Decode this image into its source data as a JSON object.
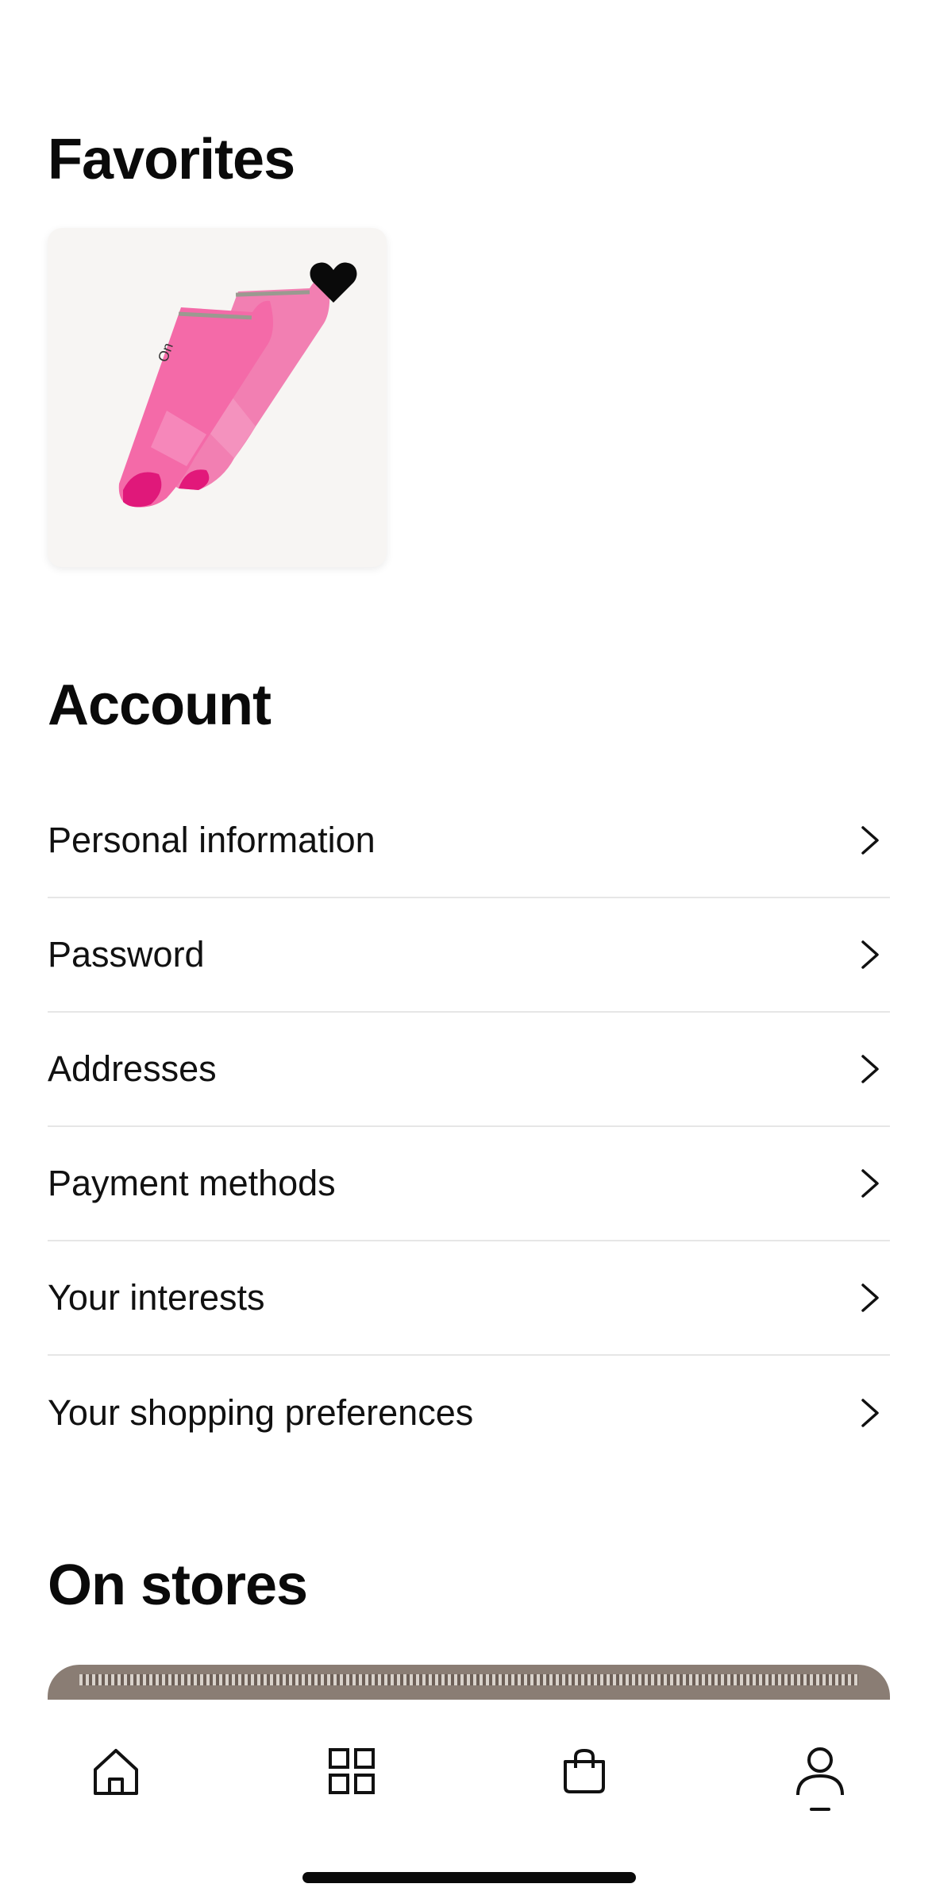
{
  "favorites": {
    "title": "Favorites",
    "items": [
      {
        "name": "pink-running-socks",
        "favorited": true
      }
    ]
  },
  "account": {
    "title": "Account",
    "items": [
      {
        "label": "Personal information"
      },
      {
        "label": "Password"
      },
      {
        "label": "Addresses"
      },
      {
        "label": "Payment methods"
      },
      {
        "label": "Your interests"
      },
      {
        "label": "Your shopping preferences"
      }
    ]
  },
  "stores": {
    "title": "On stores"
  },
  "tabbar": {
    "items": [
      {
        "icon": "home-icon"
      },
      {
        "icon": "grid-icon"
      },
      {
        "icon": "shopping-bag-icon"
      },
      {
        "icon": "person-icon",
        "active": true
      }
    ]
  },
  "colors": {
    "background": "#ffffff",
    "text": "#111111",
    "divider": "#e6e6e6",
    "sock_pink": "#f46aa8",
    "sock_toe": "#e0187a"
  }
}
